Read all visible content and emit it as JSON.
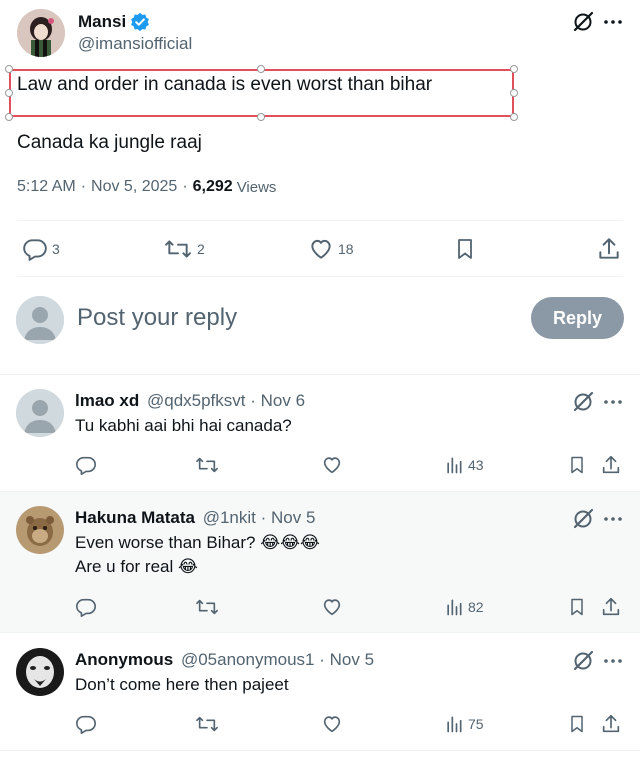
{
  "tweet": {
    "author_name": "Mansi",
    "author_handle": "@imansiofficial",
    "text_line1": "Law and order in canada is even worst than bihar",
    "text_line2": "Canada ka jungle raaj",
    "time": "5:12 AM",
    "date": "Nov 5, 2025",
    "views_count": "6,292",
    "views_label": "Views",
    "replies": "3",
    "reposts": "2",
    "likes": "18"
  },
  "compose": {
    "placeholder": "Post your reply",
    "button_label": "Reply"
  },
  "replies": [
    {
      "name": "lmao xd",
      "handle": "@qdx5pfksvt",
      "date": "Nov 6",
      "line1": "Tu kabhi aai bhi hai canada?",
      "line2": "",
      "views": "43"
    },
    {
      "name": "Hakuna Matata",
      "handle": "@1nkit",
      "date": "Nov 5",
      "line1": "Even worse than Bihar? 😂😂😂",
      "line2": "Are u for real 😂",
      "views": "82"
    },
    {
      "name": "Anonymous",
      "handle": "@05anonymous1",
      "date": "Nov 5",
      "line1": "Don’t come here then pajeet",
      "line2": "",
      "views": "75"
    }
  ],
  "colors": {
    "accent": "#1d9bf0",
    "reply_button": "#8b98a5",
    "highlight_box": "#e0505a"
  }
}
